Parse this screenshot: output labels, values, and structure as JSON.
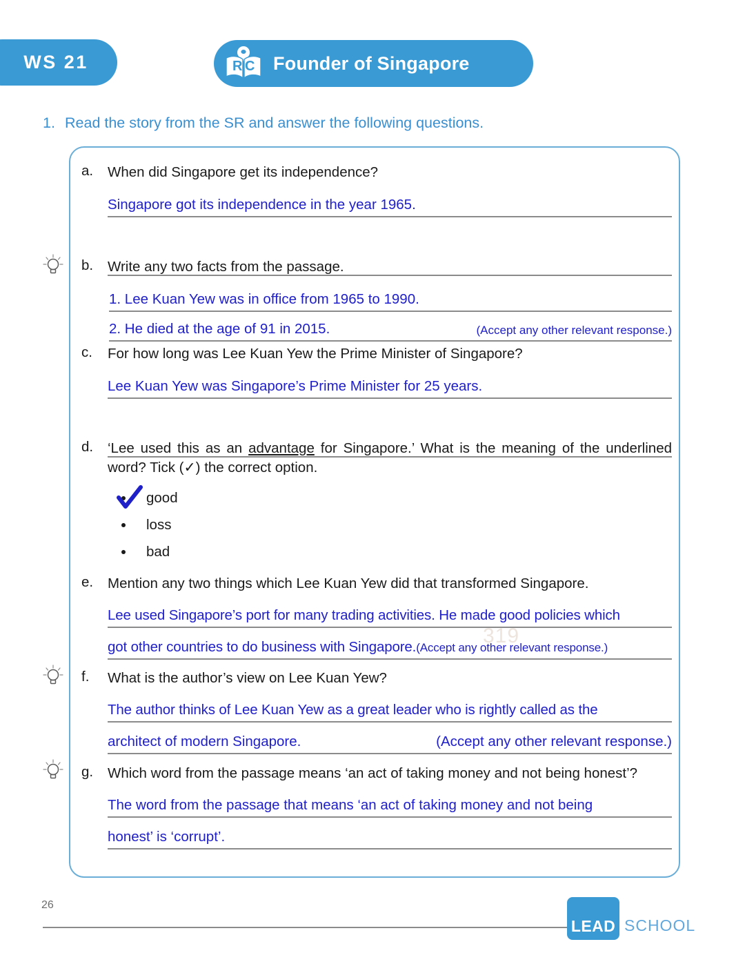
{
  "header": {
    "ws_label": "WS  21",
    "title": "Founder of Singapore",
    "icon_name": "rc-book-icon"
  },
  "instruction": {
    "number": "1.",
    "text": "Read the story from the SR and answer the following questions."
  },
  "questions": [
    {
      "letter": "a.",
      "prompt": "When did Singapore get its independence?",
      "has_bulb": false,
      "answer_lines": [
        {
          "text": "Singapore got its independence in the year 1965."
        },
        {
          "text": ""
        }
      ]
    },
    {
      "letter": "b.",
      "prompt": "Write any two facts from the passage.",
      "has_bulb": true,
      "answer_lines": [
        {
          "text": "1. Lee Kuan Yew was in office from 1965 to 1990."
        },
        {
          "text": "2. He died at the age of 91 in 2015.",
          "right": "(Accept any other relevant response.)"
        }
      ]
    },
    {
      "letter": "c.",
      "prompt": "For how long was Lee Kuan Yew the Prime Minister of Singapore?",
      "has_bulb": false,
      "answer_lines": [
        {
          "text": "Lee Kuan Yew was Singapore’s Prime Minister for 25 years."
        },
        {
          "text": ""
        }
      ]
    },
    {
      "letter": "d.",
      "prompt_pre": "‘Lee used this as an ",
      "prompt_underlined": "advantage",
      "prompt_post": " for Singapore.’ What is the meaning of the underlined word? Tick (✓) the correct option.",
      "has_bulb": false,
      "options": [
        {
          "label": "good",
          "ticked": true
        },
        {
          "label": "loss",
          "ticked": false
        },
        {
          "label": "bad",
          "ticked": false
        }
      ]
    },
    {
      "letter": "e.",
      "prompt": "Mention any two things which Lee Kuan Yew did that transformed Singapore.",
      "has_bulb": false,
      "answer_lines": [
        {
          "text": "Lee used Singapore’s port for many trading activities. He made good policies which"
        },
        {
          "text": "got other countries to do business with Singapore.",
          "inline_note": "(Accept any other relevant response.)"
        }
      ]
    },
    {
      "letter": "f.",
      "prompt": "What is the author’s view on Lee Kuan Yew?",
      "has_bulb": true,
      "answer_lines": [
        {
          "text": "The author thinks of Lee Kuan Yew as a great leader who is rightly called as the"
        },
        {
          "text": "architect of modern Singapore.",
          "right": "(Accept any other relevant response.)"
        }
      ]
    },
    {
      "letter": "g.",
      "prompt": "Which word from the passage means ‘an act of taking money and not being honest’?",
      "has_bulb": true,
      "answer_lines": [
        {
          "text": "The word from the passage that means ‘an act of taking money and not being"
        },
        {
          "text": "honest’ is ‘corrupt’."
        }
      ]
    }
  ],
  "watermark": "319",
  "footer": {
    "page_number": "26",
    "logo_primary": "LEAD",
    "logo_secondary": "SCHOOL"
  },
  "colors": {
    "brand_blue": "#3a9ad4",
    "instruction_blue": "#3a8fd0",
    "answer_blue": "#2020c8",
    "box_border": "#6aaed8",
    "rule_gray": "#8b8b8b"
  }
}
